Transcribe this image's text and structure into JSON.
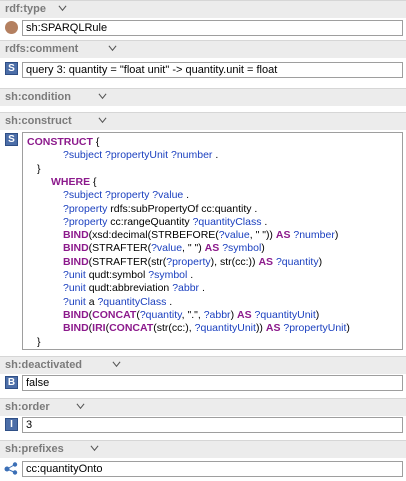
{
  "sections": {
    "rdf_type": "rdf:type",
    "rdfs_comment": "rdfs:comment",
    "sh_condition": "sh:condition",
    "sh_construct": "sh:construct",
    "sh_deactivated": "sh:deactivated",
    "sh_order": "sh:order",
    "sh_prefixes": "sh:prefixes"
  },
  "values": {
    "rdf_type": "sh:SPARQLRule",
    "rdfs_comment": "query 3: quantity = \"float unit\" -> quantity.unit = float",
    "sh_deactivated": "false",
    "sh_order": "3",
    "sh_prefixes": "cc:quantityOnto"
  },
  "icons": {
    "class_icon": "class-circle-icon",
    "string_icon": "S",
    "boolean_icon": "B",
    "integer_icon": "I",
    "prefix_icon": "ontology-graph-icon"
  },
  "code_lines": [
    {
      "indent": 4,
      "parts": [
        [
          "kw",
          "CONSTRUCT"
        ],
        [
          "pl",
          " {"
        ]
      ]
    },
    {
      "indent": 40,
      "parts": [
        [
          "pv",
          "?subject ?propertyUnit ?number"
        ],
        [
          "pl",
          " ."
        ]
      ]
    },
    {
      "indent": 14,
      "parts": [
        [
          "pl",
          "}"
        ]
      ]
    },
    {
      "indent": 28,
      "parts": [
        [
          "kw",
          "WHERE"
        ],
        [
          "pl",
          " {"
        ]
      ]
    },
    {
      "indent": 40,
      "parts": [
        [
          "pv",
          "?subject ?property ?value"
        ],
        [
          "pl",
          " ."
        ]
      ]
    },
    {
      "indent": 40,
      "parts": [
        [
          "pv",
          "?property"
        ],
        [
          "pl",
          " rdfs:subPropertyOf cc:quantity ."
        ]
      ]
    },
    {
      "indent": 40,
      "parts": [
        [
          "pv",
          "?property"
        ],
        [
          "pl",
          " cc:rangeQuantity "
        ],
        [
          "pv",
          "?quantityClass"
        ],
        [
          "pl",
          " ."
        ]
      ]
    },
    {
      "indent": 40,
      "parts": [
        [
          "kw",
          "BIND"
        ],
        [
          "pl",
          "(xsd:decimal(STRBEFORE("
        ],
        [
          "pv",
          "?value"
        ],
        [
          "pl",
          ", \" \")) "
        ],
        [
          "kw",
          "AS"
        ],
        [
          "pl",
          " "
        ],
        [
          "pv",
          "?number"
        ],
        [
          "pl",
          ")"
        ]
      ]
    },
    {
      "indent": 40,
      "parts": [
        [
          "kw",
          "BIND"
        ],
        [
          "pl",
          "(STRAFTER("
        ],
        [
          "pv",
          "?value"
        ],
        [
          "pl",
          ", \" \") "
        ],
        [
          "kw",
          "AS"
        ],
        [
          "pl",
          " "
        ],
        [
          "pv",
          "?symbol"
        ],
        [
          "pl",
          ")"
        ]
      ]
    },
    {
      "indent": 40,
      "parts": [
        [
          "kw",
          "BIND"
        ],
        [
          "pl",
          "(STRAFTER(str("
        ],
        [
          "pv",
          "?property"
        ],
        [
          "pl",
          "), str(cc:)) "
        ],
        [
          "kw",
          "AS"
        ],
        [
          "pl",
          " "
        ],
        [
          "pv",
          "?quantity"
        ],
        [
          "pl",
          ")"
        ]
      ]
    },
    {
      "indent": 40,
      "parts": [
        [
          "pv",
          "?unit"
        ],
        [
          "pl",
          " qudt:symbol "
        ],
        [
          "pv",
          "?symbol"
        ],
        [
          "pl",
          " ."
        ]
      ]
    },
    {
      "indent": 40,
      "parts": [
        [
          "pv",
          "?unit"
        ],
        [
          "pl",
          " qudt:abbreviation "
        ],
        [
          "pv",
          "?abbr"
        ],
        [
          "pl",
          " ."
        ]
      ]
    },
    {
      "indent": 40,
      "parts": [
        [
          "pv",
          "?unit"
        ],
        [
          "pl",
          " a "
        ],
        [
          "pv",
          "?quantityClass"
        ],
        [
          "pl",
          " ."
        ]
      ]
    },
    {
      "indent": 40,
      "parts": [
        [
          "kw",
          "BIND"
        ],
        [
          "pl",
          "("
        ],
        [
          "kw",
          "CONCAT"
        ],
        [
          "pl",
          "("
        ],
        [
          "pv",
          "?quantity"
        ],
        [
          "pl",
          ", \".\", "
        ],
        [
          "pv",
          "?abbr"
        ],
        [
          "pl",
          ") "
        ],
        [
          "kw",
          "AS"
        ],
        [
          "pl",
          " "
        ],
        [
          "pv",
          "?quantityUnit"
        ],
        [
          "pl",
          ")"
        ]
      ]
    },
    {
      "indent": 40,
      "parts": [
        [
          "kw",
          "BIND"
        ],
        [
          "pl",
          "("
        ],
        [
          "kw",
          "IRI"
        ],
        [
          "pl",
          "("
        ],
        [
          "kw",
          "CONCAT"
        ],
        [
          "pl",
          "(str(cc:), "
        ],
        [
          "pv",
          "?quantityUnit"
        ],
        [
          "pl",
          ")) "
        ],
        [
          "kw",
          "AS"
        ],
        [
          "pl",
          " "
        ],
        [
          "pv",
          "?propertyUnit"
        ],
        [
          "pl",
          ")"
        ]
      ]
    },
    {
      "indent": 14,
      "parts": [
        [
          "pl",
          "}"
        ]
      ]
    }
  ]
}
